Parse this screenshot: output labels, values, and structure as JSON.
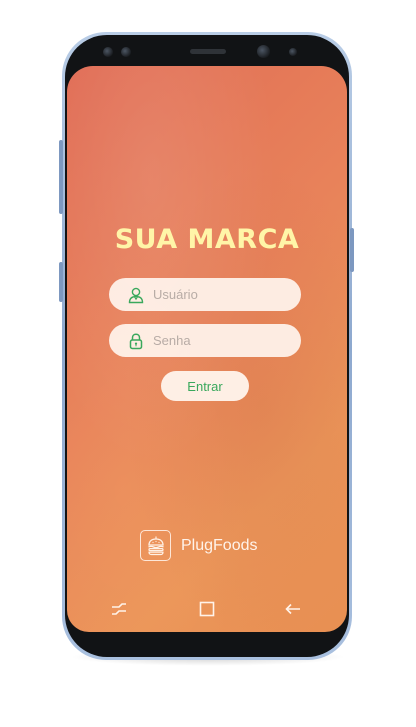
{
  "app": {
    "brand_title": "SUA MARCA",
    "logo_name": "PlugFoods"
  },
  "login": {
    "username_placeholder": "Usuário",
    "password_placeholder": "Senha",
    "submit_label": "Entrar"
  },
  "icons": {
    "username_field": "user-icon",
    "password_field": "lock-icon",
    "logo": "burger-icon",
    "nav_recent": "recent-apps-icon",
    "nav_home": "home-square-icon",
    "nav_back": "back-arrow-icon"
  },
  "colors": {
    "title": "#fff5a8",
    "accent_green": "#3aa85c",
    "background_start": "#e06c55",
    "background_end": "#eb9559"
  }
}
